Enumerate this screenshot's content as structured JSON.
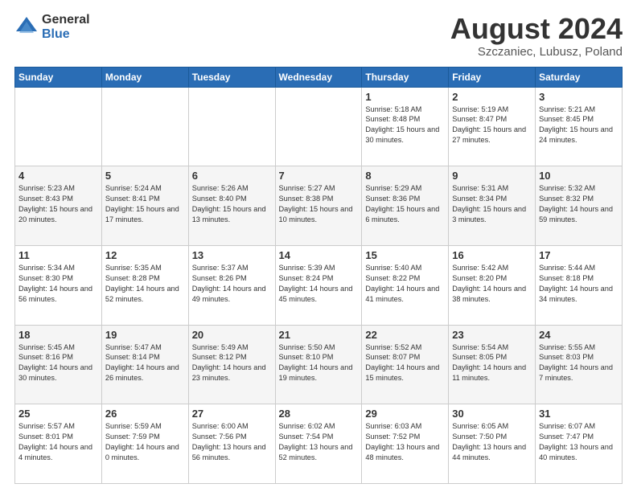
{
  "logo": {
    "general": "General",
    "blue": "Blue"
  },
  "header": {
    "title": "August 2024",
    "subtitle": "Szczaniec, Lubusz, Poland"
  },
  "weekdays": [
    "Sunday",
    "Monday",
    "Tuesday",
    "Wednesday",
    "Thursday",
    "Friday",
    "Saturday"
  ],
  "weeks": [
    [
      {
        "day": "",
        "info": ""
      },
      {
        "day": "",
        "info": ""
      },
      {
        "day": "",
        "info": ""
      },
      {
        "day": "",
        "info": ""
      },
      {
        "day": "1",
        "info": "Sunrise: 5:18 AM\nSunset: 8:48 PM\nDaylight: 15 hours\nand 30 minutes."
      },
      {
        "day": "2",
        "info": "Sunrise: 5:19 AM\nSunset: 8:47 PM\nDaylight: 15 hours\nand 27 minutes."
      },
      {
        "day": "3",
        "info": "Sunrise: 5:21 AM\nSunset: 8:45 PM\nDaylight: 15 hours\nand 24 minutes."
      }
    ],
    [
      {
        "day": "4",
        "info": "Sunrise: 5:23 AM\nSunset: 8:43 PM\nDaylight: 15 hours\nand 20 minutes."
      },
      {
        "day": "5",
        "info": "Sunrise: 5:24 AM\nSunset: 8:41 PM\nDaylight: 15 hours\nand 17 minutes."
      },
      {
        "day": "6",
        "info": "Sunrise: 5:26 AM\nSunset: 8:40 PM\nDaylight: 15 hours\nand 13 minutes."
      },
      {
        "day": "7",
        "info": "Sunrise: 5:27 AM\nSunset: 8:38 PM\nDaylight: 15 hours\nand 10 minutes."
      },
      {
        "day": "8",
        "info": "Sunrise: 5:29 AM\nSunset: 8:36 PM\nDaylight: 15 hours\nand 6 minutes."
      },
      {
        "day": "9",
        "info": "Sunrise: 5:31 AM\nSunset: 8:34 PM\nDaylight: 15 hours\nand 3 minutes."
      },
      {
        "day": "10",
        "info": "Sunrise: 5:32 AM\nSunset: 8:32 PM\nDaylight: 14 hours\nand 59 minutes."
      }
    ],
    [
      {
        "day": "11",
        "info": "Sunrise: 5:34 AM\nSunset: 8:30 PM\nDaylight: 14 hours\nand 56 minutes."
      },
      {
        "day": "12",
        "info": "Sunrise: 5:35 AM\nSunset: 8:28 PM\nDaylight: 14 hours\nand 52 minutes."
      },
      {
        "day": "13",
        "info": "Sunrise: 5:37 AM\nSunset: 8:26 PM\nDaylight: 14 hours\nand 49 minutes."
      },
      {
        "day": "14",
        "info": "Sunrise: 5:39 AM\nSunset: 8:24 PM\nDaylight: 14 hours\nand 45 minutes."
      },
      {
        "day": "15",
        "info": "Sunrise: 5:40 AM\nSunset: 8:22 PM\nDaylight: 14 hours\nand 41 minutes."
      },
      {
        "day": "16",
        "info": "Sunrise: 5:42 AM\nSunset: 8:20 PM\nDaylight: 14 hours\nand 38 minutes."
      },
      {
        "day": "17",
        "info": "Sunrise: 5:44 AM\nSunset: 8:18 PM\nDaylight: 14 hours\nand 34 minutes."
      }
    ],
    [
      {
        "day": "18",
        "info": "Sunrise: 5:45 AM\nSunset: 8:16 PM\nDaylight: 14 hours\nand 30 minutes."
      },
      {
        "day": "19",
        "info": "Sunrise: 5:47 AM\nSunset: 8:14 PM\nDaylight: 14 hours\nand 26 minutes."
      },
      {
        "day": "20",
        "info": "Sunrise: 5:49 AM\nSunset: 8:12 PM\nDaylight: 14 hours\nand 23 minutes."
      },
      {
        "day": "21",
        "info": "Sunrise: 5:50 AM\nSunset: 8:10 PM\nDaylight: 14 hours\nand 19 minutes."
      },
      {
        "day": "22",
        "info": "Sunrise: 5:52 AM\nSunset: 8:07 PM\nDaylight: 14 hours\nand 15 minutes."
      },
      {
        "day": "23",
        "info": "Sunrise: 5:54 AM\nSunset: 8:05 PM\nDaylight: 14 hours\nand 11 minutes."
      },
      {
        "day": "24",
        "info": "Sunrise: 5:55 AM\nSunset: 8:03 PM\nDaylight: 14 hours\nand 7 minutes."
      }
    ],
    [
      {
        "day": "25",
        "info": "Sunrise: 5:57 AM\nSunset: 8:01 PM\nDaylight: 14 hours\nand 4 minutes."
      },
      {
        "day": "26",
        "info": "Sunrise: 5:59 AM\nSunset: 7:59 PM\nDaylight: 14 hours\nand 0 minutes."
      },
      {
        "day": "27",
        "info": "Sunrise: 6:00 AM\nSunset: 7:56 PM\nDaylight: 13 hours\nand 56 minutes."
      },
      {
        "day": "28",
        "info": "Sunrise: 6:02 AM\nSunset: 7:54 PM\nDaylight: 13 hours\nand 52 minutes."
      },
      {
        "day": "29",
        "info": "Sunrise: 6:03 AM\nSunset: 7:52 PM\nDaylight: 13 hours\nand 48 minutes."
      },
      {
        "day": "30",
        "info": "Sunrise: 6:05 AM\nSunset: 7:50 PM\nDaylight: 13 hours\nand 44 minutes."
      },
      {
        "day": "31",
        "info": "Sunrise: 6:07 AM\nSunset: 7:47 PM\nDaylight: 13 hours\nand 40 minutes."
      }
    ]
  ]
}
